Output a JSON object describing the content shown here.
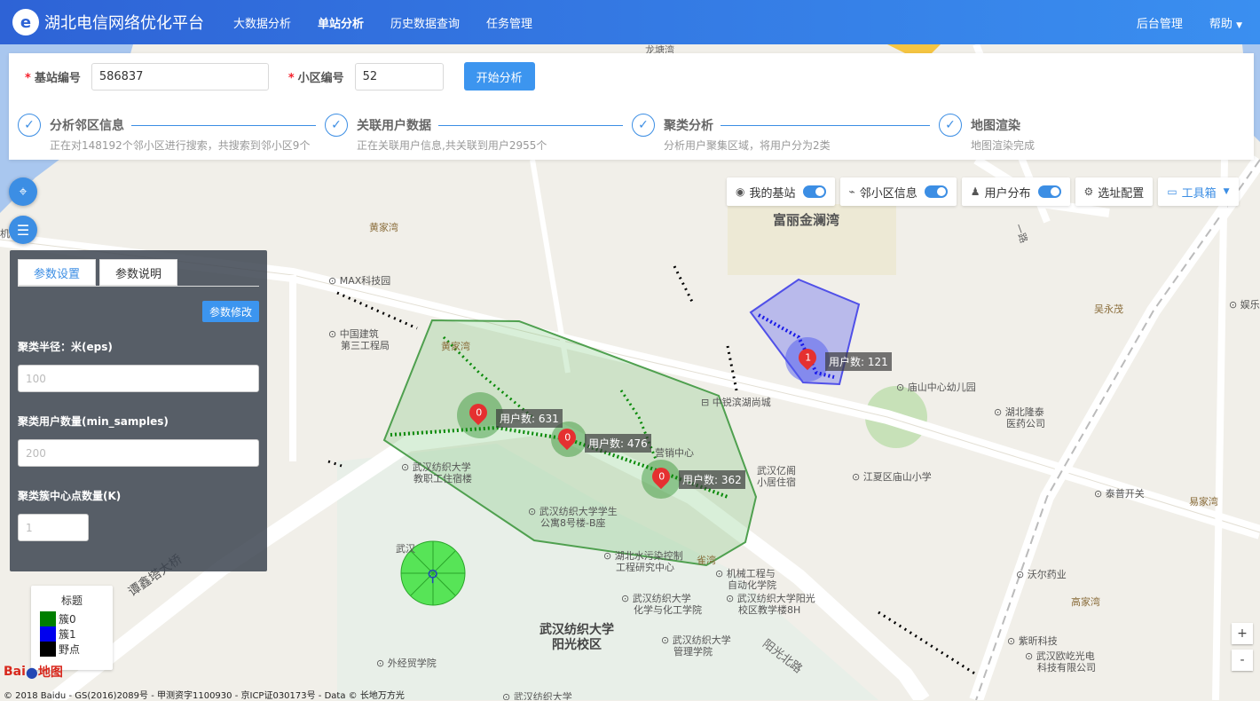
{
  "app": {
    "logo_glyph": "e",
    "title": "湖北电信网络优化平台"
  },
  "nav": [
    "大数据分析",
    "单站分析",
    "历史数据查询",
    "任务管理"
  ],
  "nav_active": 1,
  "right_nav": {
    "admin": "后台管理",
    "help": "帮助"
  },
  "form": {
    "station_label": "基站编号",
    "station_value": "586837",
    "cell_label": "小区编号",
    "cell_value": "52",
    "required_mark": "*",
    "start_button": "开始分析"
  },
  "steps": [
    {
      "title": "分析邻区信息",
      "desc": "正在对148192个邻小区进行搜索，共搜索到邻小区9个"
    },
    {
      "title": "关联用户数据",
      "desc": "正在关联用户信息,共关联到用户2955个"
    },
    {
      "title": "聚类分析",
      "desc": "分析用户聚集区域，将用户分为2类"
    },
    {
      "title": "地图渲染",
      "desc": "地图渲染完成"
    }
  ],
  "controls": {
    "my_station": "我的基站",
    "neighbor": "邻小区信息",
    "user_dist": "用户分布",
    "site_config": "选址配置",
    "toolbox": "工具箱"
  },
  "panel": {
    "tab_settings": "参数设置",
    "tab_help": "参数说明",
    "modify_button": "参数修改",
    "eps_label": "聚类半径：米(eps)",
    "eps_placeholder": "100",
    "samples_label": "聚类用户数量(min_samples)",
    "samples_placeholder": "200",
    "k_label": "聚类簇中心点数量(K)",
    "k_placeholder": "1"
  },
  "legend": {
    "title": "标题",
    "items": [
      {
        "label": "簇0",
        "color": "#007f00"
      },
      {
        "label": "簇1",
        "color": "#0000ee"
      },
      {
        "label": "野点",
        "color": "#000000"
      }
    ]
  },
  "markers": [
    {
      "id": "0",
      "label": "用户数: 631"
    },
    {
      "id": "0",
      "label": "用户数: 476"
    },
    {
      "id": "0",
      "label": "用户数: 362"
    },
    {
      "id": "1",
      "label": "用户数: 121"
    }
  ],
  "map_labels": {
    "l1": "龙塘湾",
    "l2": "富丽金澜湾",
    "l3": "黄家湾",
    "l4": "MAX科技园",
    "l5": "中国建筑",
    "l5b": "第三工程局",
    "l6": "黄家湾",
    "l7": "中锐滨湖尚城",
    "l8": "营销中心",
    "l9": "武汉亿阁",
    "l9b": "小居住宿",
    "l10": "武汉纺织大学",
    "l10b": "教职工住宿楼",
    "l11": "武汉纺织大学学生",
    "l11b": "公寓8号楼-B座",
    "l12": "湖北水污染控制",
    "l12b": "工程研究中心",
    "l13": "机械工程与",
    "l13b": "自动化学院",
    "l14": "武汉纺织大学",
    "l14b": "化学与化工学院",
    "l15": "武汉纺织大学阳光",
    "l15b": "校区教学楼8H",
    "l16": "武汉纺织大学",
    "l16b": "阳光校区",
    "l17": "武汉纺织大学",
    "l17b": "管理学院",
    "l18": "外经贸学院",
    "l19": "庙山中心幼儿园",
    "l20": "湖北隆泰",
    "l20b": "医药公司",
    "l21": "江夏区庙山小学",
    "l22": "泰普开关",
    "l23": "易家湾",
    "l24": "吴永茂",
    "l25": "沃尔药业",
    "l26": "高家湾",
    "l27": "紫昕科技",
    "l28": "武汉欧屹光电",
    "l28b": "科技有限公司",
    "l29": "谭鑫塔大桥",
    "l30": "阳光北路",
    "l31": "娱乐",
    "l32": "武汉纺织大学",
    "l33": "雀湾",
    "l34": "一路",
    "l35": "武汉",
    "l36": "机"
  },
  "zoom": {
    "in": "+",
    "out": "-"
  },
  "copyright": "© 2018 Baidu - GS(2016)2089号 - 甲测资字1100930 - 京ICP证030173号 - Data © 长地万方光",
  "baidu": {
    "logo": "Bai",
    "logo2": "地图",
    "paw": "●"
  }
}
